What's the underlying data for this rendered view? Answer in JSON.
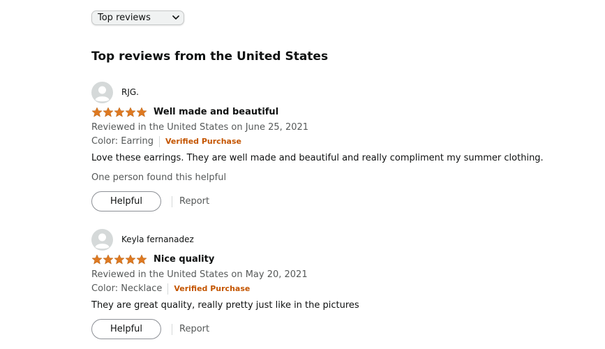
{
  "sort": {
    "selected": "Top reviews"
  },
  "section_title": "Top reviews from the United States",
  "colors": {
    "star": "#de7921",
    "verified": "#c45500",
    "muted_text": "#565959"
  },
  "reviews": [
    {
      "reviewer": "RJG.",
      "rating": 5,
      "title": "Well made and beautiful",
      "date_line": "Reviewed in the United States on June 25, 2021",
      "variant": "Color: Earring",
      "verified": "Verified Purchase",
      "body": "Love these earrings. They are well made and beautiful and really compliment my summer clothing.",
      "helpful_count": "One person found this helpful",
      "helpful_label": "Helpful",
      "report_label": "Report"
    },
    {
      "reviewer": "Keyla fernanadez",
      "rating": 5,
      "title": "Nice quality",
      "date_line": "Reviewed in the United States on May 20, 2021",
      "variant": "Color: Necklace",
      "verified": "Verified Purchase",
      "body": "They are great quality, really pretty just like in the pictures",
      "helpful_label": "Helpful",
      "report_label": "Report"
    }
  ]
}
